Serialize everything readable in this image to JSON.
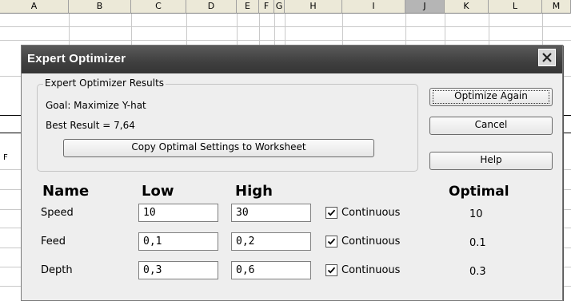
{
  "sheet": {
    "columns": [
      "A",
      "B",
      "C",
      "D",
      "E",
      "F",
      "G",
      "H",
      "I",
      "J",
      "K",
      "L",
      "M"
    ],
    "row_marker": "F"
  },
  "dialog": {
    "title": "Expert Optimizer",
    "results_group": {
      "label": "Expert Optimizer Results",
      "goal": "Goal: Maximize Y-hat",
      "best_result": "Best Result = 7,64",
      "copy_button": "Copy Optimal Settings to Worksheet"
    },
    "buttons": {
      "optimize_again": "Optimize Again",
      "cancel": "Cancel",
      "help": "Help"
    },
    "table": {
      "headers": {
        "name": "Name",
        "low": "Low",
        "high": "High",
        "optimal": "Optimal"
      },
      "rows": [
        {
          "name": "Speed",
          "low": "10",
          "high": "30",
          "continuous_label": "Continuous",
          "continuous_checked": true,
          "optimal": "10"
        },
        {
          "name": "Feed",
          "low": "0,1",
          "high": "0,2",
          "continuous_label": "Continuous",
          "continuous_checked": true,
          "optimal": "0.1"
        },
        {
          "name": "Depth",
          "low": "0,3",
          "high": "0,6",
          "continuous_label": "Continuous",
          "continuous_checked": true,
          "optimal": "0.3"
        }
      ]
    }
  }
}
